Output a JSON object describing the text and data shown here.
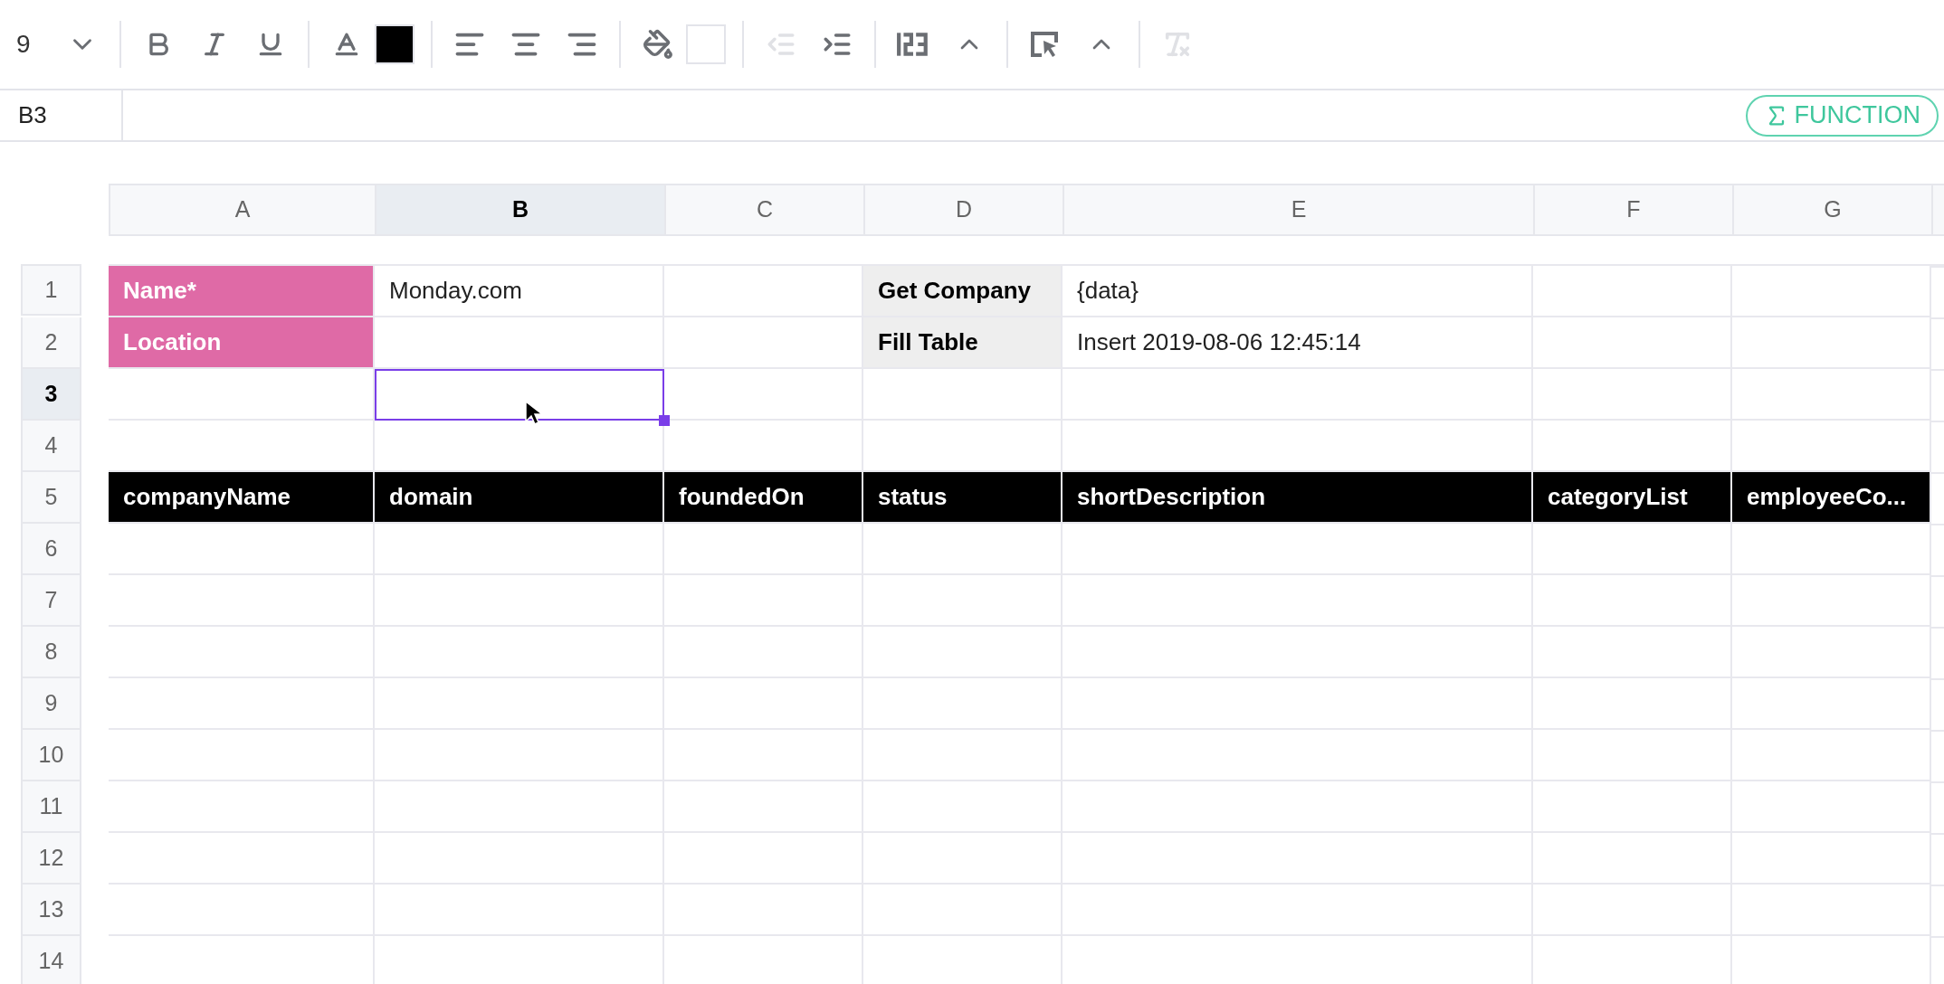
{
  "toolbar": [
    {
      "kind": "font-size",
      "value": "9"
    },
    {
      "kind": "dropdown",
      "disabled": false
    },
    {
      "kind": "separator"
    },
    {
      "kind": "bold",
      "disabled": false
    },
    {
      "kind": "italic",
      "disabled": false
    },
    {
      "kind": "underline",
      "disabled": false
    },
    {
      "kind": "separator"
    },
    {
      "kind": "text-color",
      "disabled": false
    },
    {
      "kind": "swatch",
      "color": "#000000"
    },
    {
      "kind": "separator"
    },
    {
      "kind": "align-left",
      "disabled": false
    },
    {
      "kind": "align-center",
      "disabled": false
    },
    {
      "kind": "align-right",
      "disabled": false
    },
    {
      "kind": "separator"
    },
    {
      "kind": "fill-color",
      "disabled": false
    },
    {
      "kind": "swatch",
      "color": "#ffffff"
    },
    {
      "kind": "separator"
    },
    {
      "kind": "indent-decrease",
      "disabled": true
    },
    {
      "kind": "indent-increase",
      "disabled": false
    },
    {
      "kind": "separator"
    },
    {
      "kind": "number-format",
      "disabled": false
    },
    {
      "kind": "expand",
      "disabled": false
    },
    {
      "kind": "separator"
    },
    {
      "kind": "select",
      "disabled": false
    },
    {
      "kind": "expand",
      "disabled": false
    },
    {
      "kind": "separator"
    },
    {
      "kind": "clear-format",
      "disabled": true
    }
  ],
  "formula_bar": {
    "cell_ref": "B3",
    "function_button": "FUNCTION"
  },
  "columns": [
    {
      "label": "A",
      "selected": false
    },
    {
      "label": "B",
      "selected": true
    },
    {
      "label": "C",
      "selected": false
    },
    {
      "label": "D",
      "selected": false
    },
    {
      "label": "E",
      "selected": false
    },
    {
      "label": "F",
      "selected": false
    },
    {
      "label": "G",
      "selected": false
    }
  ],
  "rows": [
    {
      "label": "1",
      "selected": false,
      "cells": [
        {
          "kind": "pink-label",
          "text": "Name*"
        },
        {
          "kind": "plain",
          "text": "Monday.com"
        },
        {
          "kind": "plain"
        },
        {
          "kind": "gray-label",
          "text": "Get Company"
        },
        {
          "kind": "plain",
          "text": "{data}"
        },
        {
          "kind": "plain"
        },
        {
          "kind": "plain"
        }
      ]
    },
    {
      "label": "2",
      "selected": false,
      "cells": [
        {
          "kind": "pink-label",
          "text": "Location"
        },
        {
          "kind": "plain"
        },
        {
          "kind": "plain"
        },
        {
          "kind": "gray-label",
          "text": "Fill Table"
        },
        {
          "kind": "plain",
          "text": "Insert 2019-08-06 12:45:14"
        },
        {
          "kind": "plain"
        },
        {
          "kind": "plain"
        }
      ]
    },
    {
      "label": "3",
      "selected": true
    },
    {
      "label": "4",
      "selected": false
    },
    {
      "label": "5",
      "selected": false,
      "cells": [
        {
          "kind": "header",
          "text": "companyName"
        },
        {
          "kind": "header",
          "text": "domain"
        },
        {
          "kind": "header",
          "text": "foundedOn"
        },
        {
          "kind": "header",
          "text": "status"
        },
        {
          "kind": "header",
          "text": "shortDescription"
        },
        {
          "kind": "header",
          "text": "categoryList"
        },
        {
          "kind": "header",
          "text": "employeeCo..."
        }
      ]
    },
    {
      "label": "6",
      "selected": false
    },
    {
      "label": "7",
      "selected": false
    },
    {
      "label": "8",
      "selected": false
    },
    {
      "label": "9",
      "selected": false
    },
    {
      "label": "10",
      "selected": false
    },
    {
      "label": "11",
      "selected": false
    },
    {
      "label": "12",
      "selected": false
    },
    {
      "label": "13",
      "selected": false
    },
    {
      "label": "14",
      "selected": false
    }
  ]
}
